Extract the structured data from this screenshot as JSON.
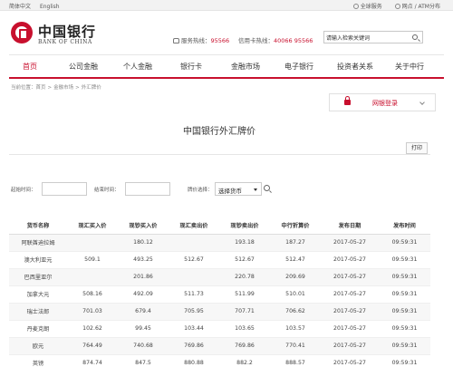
{
  "topbar": {
    "lang_zh": "简体中文",
    "lang_en": "English",
    "global_service": "全球服务",
    "network_atm": "网点 / ATM分布"
  },
  "brand": {
    "name_zh": "中国银行",
    "name_en": "BANK OF CHINA",
    "color": "#c8102e"
  },
  "hotline": {
    "service_label": "服务热线：",
    "service_number": "95566",
    "card_label": "信用卡热线：",
    "card_number": "40066 95566"
  },
  "search": {
    "value": "请输入检索关键词"
  },
  "nav": {
    "items": [
      {
        "label": "首页"
      },
      {
        "label": "公司金融"
      },
      {
        "label": "个人金融"
      },
      {
        "label": "银行卡"
      },
      {
        "label": "金融市场"
      },
      {
        "label": "电子银行"
      },
      {
        "label": "投资者关系"
      },
      {
        "label": "关于中行"
      }
    ]
  },
  "breadcrumb": {
    "prefix": "当前位置：",
    "items": [
      "首页",
      "金融市场",
      "外汇牌价"
    ],
    "sep": ">"
  },
  "login": {
    "label": "网银登录"
  },
  "page": {
    "title": "中国银行外汇牌价",
    "print_label": "打印"
  },
  "filter": {
    "start_label": "起始时间：",
    "end_label": "结束时间：",
    "currency_label": "牌价选择：",
    "currency_value": "选择货币"
  },
  "table": {
    "headers": [
      "货币名称",
      "现汇买入价",
      "现钞买入价",
      "现汇卖出价",
      "现钞卖出价",
      "中行折算价",
      "发布日期",
      "发布时间"
    ],
    "rows": [
      [
        "阿联酋迪拉姆",
        "",
        "180.12",
        "",
        "193.18",
        "187.27",
        "2017-05-27",
        "09:59:31"
      ],
      [
        "澳大利亚元",
        "509.1",
        "493.25",
        "512.67",
        "512.67",
        "512.47",
        "2017-05-27",
        "09:59:31"
      ],
      [
        "巴西里亚尔",
        "",
        "201.86",
        "",
        "220.78",
        "209.69",
        "2017-05-27",
        "09:59:31"
      ],
      [
        "加拿大元",
        "508.16",
        "492.09",
        "511.73",
        "511.99",
        "510.01",
        "2017-05-27",
        "09:59:31"
      ],
      [
        "瑞士法郎",
        "701.03",
        "679.4",
        "705.95",
        "707.71",
        "706.62",
        "2017-05-27",
        "09:59:31"
      ],
      [
        "丹麦克朗",
        "102.62",
        "99.45",
        "103.44",
        "103.65",
        "103.57",
        "2017-05-27",
        "09:59:31"
      ],
      [
        "欧元",
        "764.49",
        "740.68",
        "769.86",
        "769.86",
        "770.41",
        "2017-05-27",
        "09:59:31"
      ],
      [
        "英镑",
        "874.74",
        "847.5",
        "880.88",
        "882.2",
        "888.57",
        "2017-05-27",
        "09:59:31"
      ]
    ]
  }
}
